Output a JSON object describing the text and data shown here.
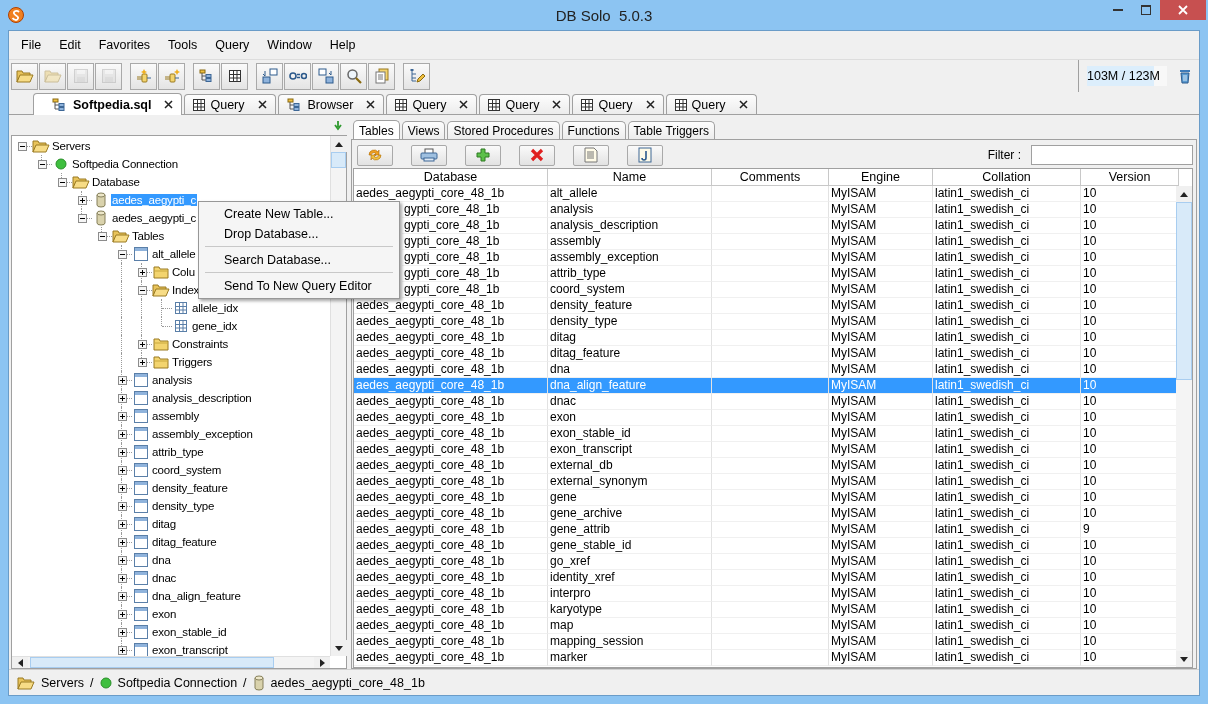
{
  "window": {
    "title": "DB Solo  5.0.3"
  },
  "menu": [
    "File",
    "Edit",
    "Favorites",
    "Tools",
    "Query",
    "Window",
    "Help"
  ],
  "toolbar": {
    "groups": [
      [
        {
          "disabled": false
        },
        {
          "disabled": true
        },
        {
          "disabled": true
        },
        {
          "disabled": true
        }
      ],
      [
        {
          "disabled": false
        },
        {
          "disabled": false
        }
      ],
      [
        {
          "disabled": false
        },
        {
          "disabled": false
        }
      ],
      [
        {
          "disabled": false
        },
        {
          "disabled": false
        },
        {
          "disabled": false
        },
        {
          "disabled": false
        },
        {
          "disabled": false
        }
      ],
      [
        {
          "disabled": false
        }
      ]
    ],
    "memory": {
      "reading": "103M / 123M",
      "level": 0.84
    }
  },
  "tabs": [
    {
      "label": "Softpedia.sql",
      "kind": "schema",
      "selected": true
    },
    {
      "label": "Query",
      "kind": "query",
      "selected": false
    },
    {
      "label": "Browser",
      "kind": "schema",
      "selected": false
    },
    {
      "label": "Query",
      "kind": "query",
      "selected": false
    },
    {
      "label": "Query",
      "kind": "query",
      "selected": false
    },
    {
      "label": "Query",
      "kind": "query",
      "selected": false
    },
    {
      "label": "Query",
      "kind": "query",
      "selected": false
    }
  ],
  "tree": {
    "nodes": [
      {
        "label": "Servers",
        "kind": "folder",
        "expanded": true,
        "selected": false,
        "children": [
          {
            "label": "Softpedia Connection",
            "kind": "connection",
            "expanded": true,
            "selected": false,
            "children": [
              {
                "label": "Database",
                "kind": "folder",
                "expanded": true,
                "selected": false,
                "children": [
                  {
                    "label": "aedes_aegypti_c",
                    "kind": "database",
                    "expanded": false,
                    "selected": true
                  },
                  {
                    "label": "aedes_aegypti_c",
                    "kind": "database",
                    "expanded": true,
                    "selected": false,
                    "children": [
                      {
                        "label": "Tables",
                        "kind": "folder",
                        "expanded": true,
                        "selected": false,
                        "children": [
                          {
                            "label": "alt_allele",
                            "kind": "table",
                            "expanded": true,
                            "selected": false,
                            "children": [
                              {
                                "label": "Colu",
                                "kind": "folder",
                                "expanded": false,
                                "selected": false
                              },
                              {
                                "label": "Index",
                                "kind": "folder",
                                "expanded": true,
                                "selected": false,
                                "children": [
                                  {
                                    "label": "allele_idx",
                                    "kind": "index",
                                    "selected": false
                                  },
                                  {
                                    "label": "gene_idx",
                                    "kind": "index",
                                    "selected": false
                                  }
                                ]
                              },
                              {
                                "label": "Constraints",
                                "kind": "folder",
                                "expanded": false,
                                "selected": false
                              },
                              {
                                "label": "Triggers",
                                "kind": "folder",
                                "expanded": false,
                                "selected": false
                              }
                            ]
                          },
                          {
                            "label": "analysis",
                            "kind": "table",
                            "expanded": false,
                            "selected": false
                          },
                          {
                            "label": "analysis_description",
                            "kind": "table",
                            "expanded": false,
                            "selected": false
                          },
                          {
                            "label": "assembly",
                            "kind": "table",
                            "expanded": false,
                            "selected": false
                          },
                          {
                            "label": "assembly_exception",
                            "kind": "table",
                            "expanded": false,
                            "selected": false
                          },
                          {
                            "label": "attrib_type",
                            "kind": "table",
                            "expanded": false,
                            "selected": false
                          },
                          {
                            "label": "coord_system",
                            "kind": "table",
                            "expanded": false,
                            "selected": false
                          },
                          {
                            "label": "density_feature",
                            "kind": "table",
                            "expanded": false,
                            "selected": false
                          },
                          {
                            "label": "density_type",
                            "kind": "table",
                            "expanded": false,
                            "selected": false
                          },
                          {
                            "label": "ditag",
                            "kind": "table",
                            "expanded": false,
                            "selected": false
                          },
                          {
                            "label": "ditag_feature",
                            "kind": "table",
                            "expanded": false,
                            "selected": false
                          },
                          {
                            "label": "dna",
                            "kind": "table",
                            "expanded": false,
                            "selected": false
                          },
                          {
                            "label": "dnac",
                            "kind": "table",
                            "expanded": false,
                            "selected": false
                          },
                          {
                            "label": "dna_align_feature",
                            "kind": "table",
                            "expanded": false,
                            "selected": false
                          },
                          {
                            "label": "exon",
                            "kind": "table",
                            "expanded": false,
                            "selected": false
                          },
                          {
                            "label": "exon_stable_id",
                            "kind": "table",
                            "expanded": false,
                            "selected": false
                          },
                          {
                            "label": "exon_transcript",
                            "kind": "table",
                            "expanded": false,
                            "selected": false
                          }
                        ]
                      }
                    ]
                  }
                ]
              }
            ]
          }
        ]
      }
    ]
  },
  "context_menu": {
    "items": [
      {
        "kind": "item",
        "label": "Create New Table..."
      },
      {
        "kind": "item",
        "label": "Drop Database..."
      },
      {
        "kind": "separator"
      },
      {
        "kind": "item",
        "label": "Search Database..."
      },
      {
        "kind": "separator"
      },
      {
        "kind": "item",
        "label": "Send To New Query Editor"
      }
    ]
  },
  "browser": {
    "tabs": [
      {
        "label": "Tables",
        "selected": true
      },
      {
        "label": "Views",
        "selected": false
      },
      {
        "label": "Stored Procedures",
        "selected": false
      },
      {
        "label": "Functions",
        "selected": false
      },
      {
        "label": "Table Triggers",
        "selected": false
      }
    ],
    "filter": {
      "label": "Filter :"
    },
    "table": {
      "columns": [
        "Database",
        "Name",
        "Comments",
        "Engine",
        "Collation",
        "Version"
      ],
      "rows": [
        {
          "database": "aedes_aegypti_core_48_1b",
          "name": "alt_allele",
          "engine": "MyISAM",
          "collation": "latin1_swedish_ci",
          "version": "10",
          "selected": false
        },
        {
          "database": "gypti_core_48_1b",
          "covered": true,
          "name": "analysis",
          "engine": "MyISAM",
          "collation": "latin1_swedish_ci",
          "version": "10",
          "selected": false
        },
        {
          "database": "gypti_core_48_1b",
          "covered": true,
          "name": "analysis_description",
          "engine": "MyISAM",
          "collation": "latin1_swedish_ci",
          "version": "10",
          "selected": false
        },
        {
          "database": "gypti_core_48_1b",
          "covered": true,
          "name": "assembly",
          "engine": "MyISAM",
          "collation": "latin1_swedish_ci",
          "version": "10",
          "selected": false
        },
        {
          "database": "gypti_core_48_1b",
          "covered": true,
          "name": "assembly_exception",
          "engine": "MyISAM",
          "collation": "latin1_swedish_ci",
          "version": "10",
          "selected": false
        },
        {
          "database": "gypti_core_48_1b",
          "covered": true,
          "name": "attrib_type",
          "engine": "MyISAM",
          "collation": "latin1_swedish_ci",
          "version": "10",
          "selected": false
        },
        {
          "database": "gypti_core_48_1b",
          "covered": true,
          "name": "coord_system",
          "engine": "MyISAM",
          "collation": "latin1_swedish_ci",
          "version": "10",
          "selected": false
        },
        {
          "database": "aedes_aegypti_core_48_1b",
          "name": "density_feature",
          "engine": "MyISAM",
          "collation": "latin1_swedish_ci",
          "version": "10",
          "selected": false
        },
        {
          "database": "aedes_aegypti_core_48_1b",
          "name": "density_type",
          "engine": "MyISAM",
          "collation": "latin1_swedish_ci",
          "version": "10",
          "selected": false
        },
        {
          "database": "aedes_aegypti_core_48_1b",
          "name": "ditag",
          "engine": "MyISAM",
          "collation": "latin1_swedish_ci",
          "version": "10",
          "selected": false
        },
        {
          "database": "aedes_aegypti_core_48_1b",
          "name": "ditag_feature",
          "engine": "MyISAM",
          "collation": "latin1_swedish_ci",
          "version": "10",
          "selected": false
        },
        {
          "database": "aedes_aegypti_core_48_1b",
          "name": "dna",
          "engine": "MyISAM",
          "collation": "latin1_swedish_ci",
          "version": "10",
          "selected": false
        },
        {
          "database": "aedes_aegypti_core_48_1b",
          "name": "dna_align_feature",
          "engine": "MyISAM",
          "collation": "latin1_swedish_ci",
          "version": "10",
          "selected": true
        },
        {
          "database": "aedes_aegypti_core_48_1b",
          "name": "dnac",
          "engine": "MyISAM",
          "collation": "latin1_swedish_ci",
          "version": "10",
          "selected": false
        },
        {
          "database": "aedes_aegypti_core_48_1b",
          "name": "exon",
          "engine": "MyISAM",
          "collation": "latin1_swedish_ci",
          "version": "10",
          "selected": false
        },
        {
          "database": "aedes_aegypti_core_48_1b",
          "name": "exon_stable_id",
          "engine": "MyISAM",
          "collation": "latin1_swedish_ci",
          "version": "10",
          "selected": false
        },
        {
          "database": "aedes_aegypti_core_48_1b",
          "name": "exon_transcript",
          "engine": "MyISAM",
          "collation": "latin1_swedish_ci",
          "version": "10",
          "selected": false
        },
        {
          "database": "aedes_aegypti_core_48_1b",
          "name": "external_db",
          "engine": "MyISAM",
          "collation": "latin1_swedish_ci",
          "version": "10",
          "selected": false
        },
        {
          "database": "aedes_aegypti_core_48_1b",
          "name": "external_synonym",
          "engine": "MyISAM",
          "collation": "latin1_swedish_ci",
          "version": "10",
          "selected": false
        },
        {
          "database": "aedes_aegypti_core_48_1b",
          "name": "gene",
          "engine": "MyISAM",
          "collation": "latin1_swedish_ci",
          "version": "10",
          "selected": false
        },
        {
          "database": "aedes_aegypti_core_48_1b",
          "name": "gene_archive",
          "engine": "MyISAM",
          "collation": "latin1_swedish_ci",
          "version": "10",
          "selected": false
        },
        {
          "database": "aedes_aegypti_core_48_1b",
          "name": "gene_attrib",
          "engine": "MyISAM",
          "collation": "latin1_swedish_ci",
          "version": "9",
          "selected": false
        },
        {
          "database": "aedes_aegypti_core_48_1b",
          "name": "gene_stable_id",
          "engine": "MyISAM",
          "collation": "latin1_swedish_ci",
          "version": "10",
          "selected": false
        },
        {
          "database": "aedes_aegypti_core_48_1b",
          "name": "go_xref",
          "engine": "MyISAM",
          "collation": "latin1_swedish_ci",
          "version": "10",
          "selected": false
        },
        {
          "database": "aedes_aegypti_core_48_1b",
          "name": "identity_xref",
          "engine": "MyISAM",
          "collation": "latin1_swedish_ci",
          "version": "10",
          "selected": false
        },
        {
          "database": "aedes_aegypti_core_48_1b",
          "name": "interpro",
          "engine": "MyISAM",
          "collation": "latin1_swedish_ci",
          "version": "10",
          "selected": false
        },
        {
          "database": "aedes_aegypti_core_48_1b",
          "name": "karyotype",
          "engine": "MyISAM",
          "collation": "latin1_swedish_ci",
          "version": "10",
          "selected": false
        },
        {
          "database": "aedes_aegypti_core_48_1b",
          "name": "map",
          "engine": "MyISAM",
          "collation": "latin1_swedish_ci",
          "version": "10",
          "selected": false
        },
        {
          "database": "aedes_aegypti_core_48_1b",
          "name": "mapping_session",
          "engine": "MyISAM",
          "collation": "latin1_swedish_ci",
          "version": "10",
          "selected": false
        },
        {
          "database": "aedes_aegypti_core_48_1b",
          "name": "marker",
          "engine": "MyISAM",
          "collation": "latin1_swedish_ci",
          "version": "10",
          "selected": false
        }
      ]
    }
  },
  "status_bar": {
    "path": [
      {
        "kind": "folder",
        "label": "Servers"
      },
      {
        "kind": "separator",
        "label": "/"
      },
      {
        "kind": "connection",
        "label": "Softpedia Connection"
      },
      {
        "kind": "separator",
        "label": "/"
      },
      {
        "kind": "database",
        "label": "aedes_aegypti_core_48_1b"
      }
    ]
  }
}
